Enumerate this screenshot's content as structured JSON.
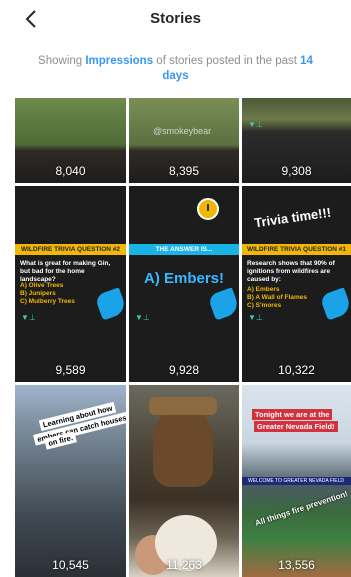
{
  "header": {
    "title": "Stories",
    "back_icon": "chevron-left-icon"
  },
  "subtitle": {
    "prefix": "Showing ",
    "metric": "Impressions",
    "middle": " of stories posted in the past ",
    "period": "14 days"
  },
  "colors": {
    "accent": "#3897f0",
    "text": "#262626",
    "muted": "#8e8e8e",
    "banner_yellow": "#f2b705",
    "banner_blue": "#1ab3e6"
  },
  "stories": [
    {
      "count": "8,040"
    },
    {
      "count": "8,395",
      "overlay_text": "@smokeybear"
    },
    {
      "count": "9,308"
    },
    {
      "count": "9,589",
      "banner": "WILDFIRE TRIVIA QUESTION #2",
      "question": "What is great for making Gin, but bad for the home landscape?",
      "answers": [
        "A) Olive Trees",
        "B) Junipers",
        "C) Mulberry Trees"
      ]
    },
    {
      "count": "9,928",
      "banner": "THE ANSWER IS...",
      "answer": "A) Embers!"
    },
    {
      "count": "10,322",
      "headline": "Trivia time!!!",
      "banner": "WILDFIRE TRIVIA QUESTION #1",
      "question": "Research shows that 90% of ignitions from wildfires are caused by:",
      "answers": [
        "A) Embers",
        "B) A Wall of Flames",
        "C) S'mores"
      ]
    },
    {
      "count": "10,545",
      "captions": [
        "Learning about how",
        "embers can catch houses",
        "on fire."
      ]
    },
    {
      "count": "11,263"
    },
    {
      "count": "13,556",
      "captions": [
        "Tonight we are at the",
        "Greater Nevada Field!",
        "All things fire prevention!"
      ],
      "sign": "WELCOME TO GREATER NEVADA FIELD"
    }
  ]
}
